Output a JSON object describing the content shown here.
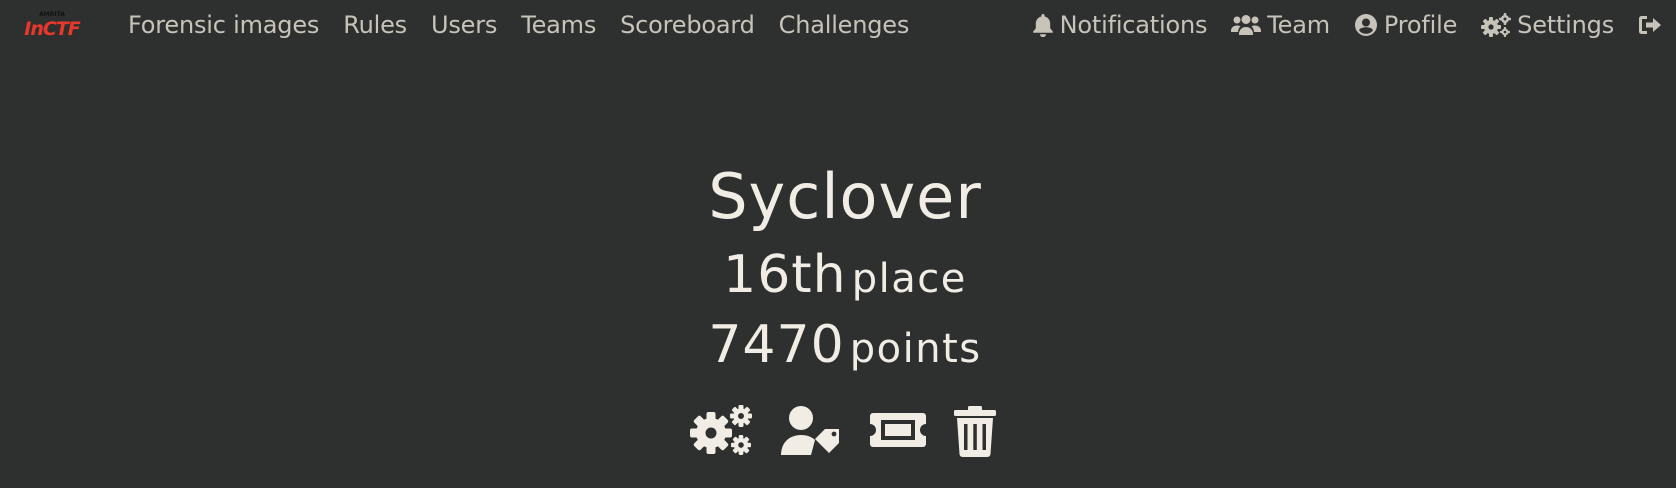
{
  "brand": {
    "logo_text": "InCTF",
    "logo_subtext": "AMRITA",
    "logo_color": "#e8382b"
  },
  "nav": {
    "left": [
      {
        "label": "Forensic images"
      },
      {
        "label": "Rules"
      },
      {
        "label": "Users"
      },
      {
        "label": "Teams"
      },
      {
        "label": "Scoreboard"
      },
      {
        "label": "Challenges"
      }
    ],
    "right": [
      {
        "label": "Notifications",
        "icon": "bell-icon"
      },
      {
        "label": "Team",
        "icon": "users-icon"
      },
      {
        "label": "Profile",
        "icon": "user-circle-icon"
      },
      {
        "label": "Settings",
        "icon": "cogs-icon"
      },
      {
        "label": "",
        "icon": "sign-out-icon"
      }
    ]
  },
  "team": {
    "name": "Syclover",
    "place_number": "16th",
    "place_label": "place",
    "points_number": "7470",
    "points_label": "points"
  },
  "actions": [
    {
      "icon": "cogs-icon"
    },
    {
      "icon": "user-tag-icon"
    },
    {
      "icon": "ticket-icon"
    },
    {
      "icon": "trash-icon"
    }
  ],
  "colors": {
    "background": "#2e3030",
    "nav_text": "#c8c3b9",
    "heading_text": "#f1ede4"
  }
}
